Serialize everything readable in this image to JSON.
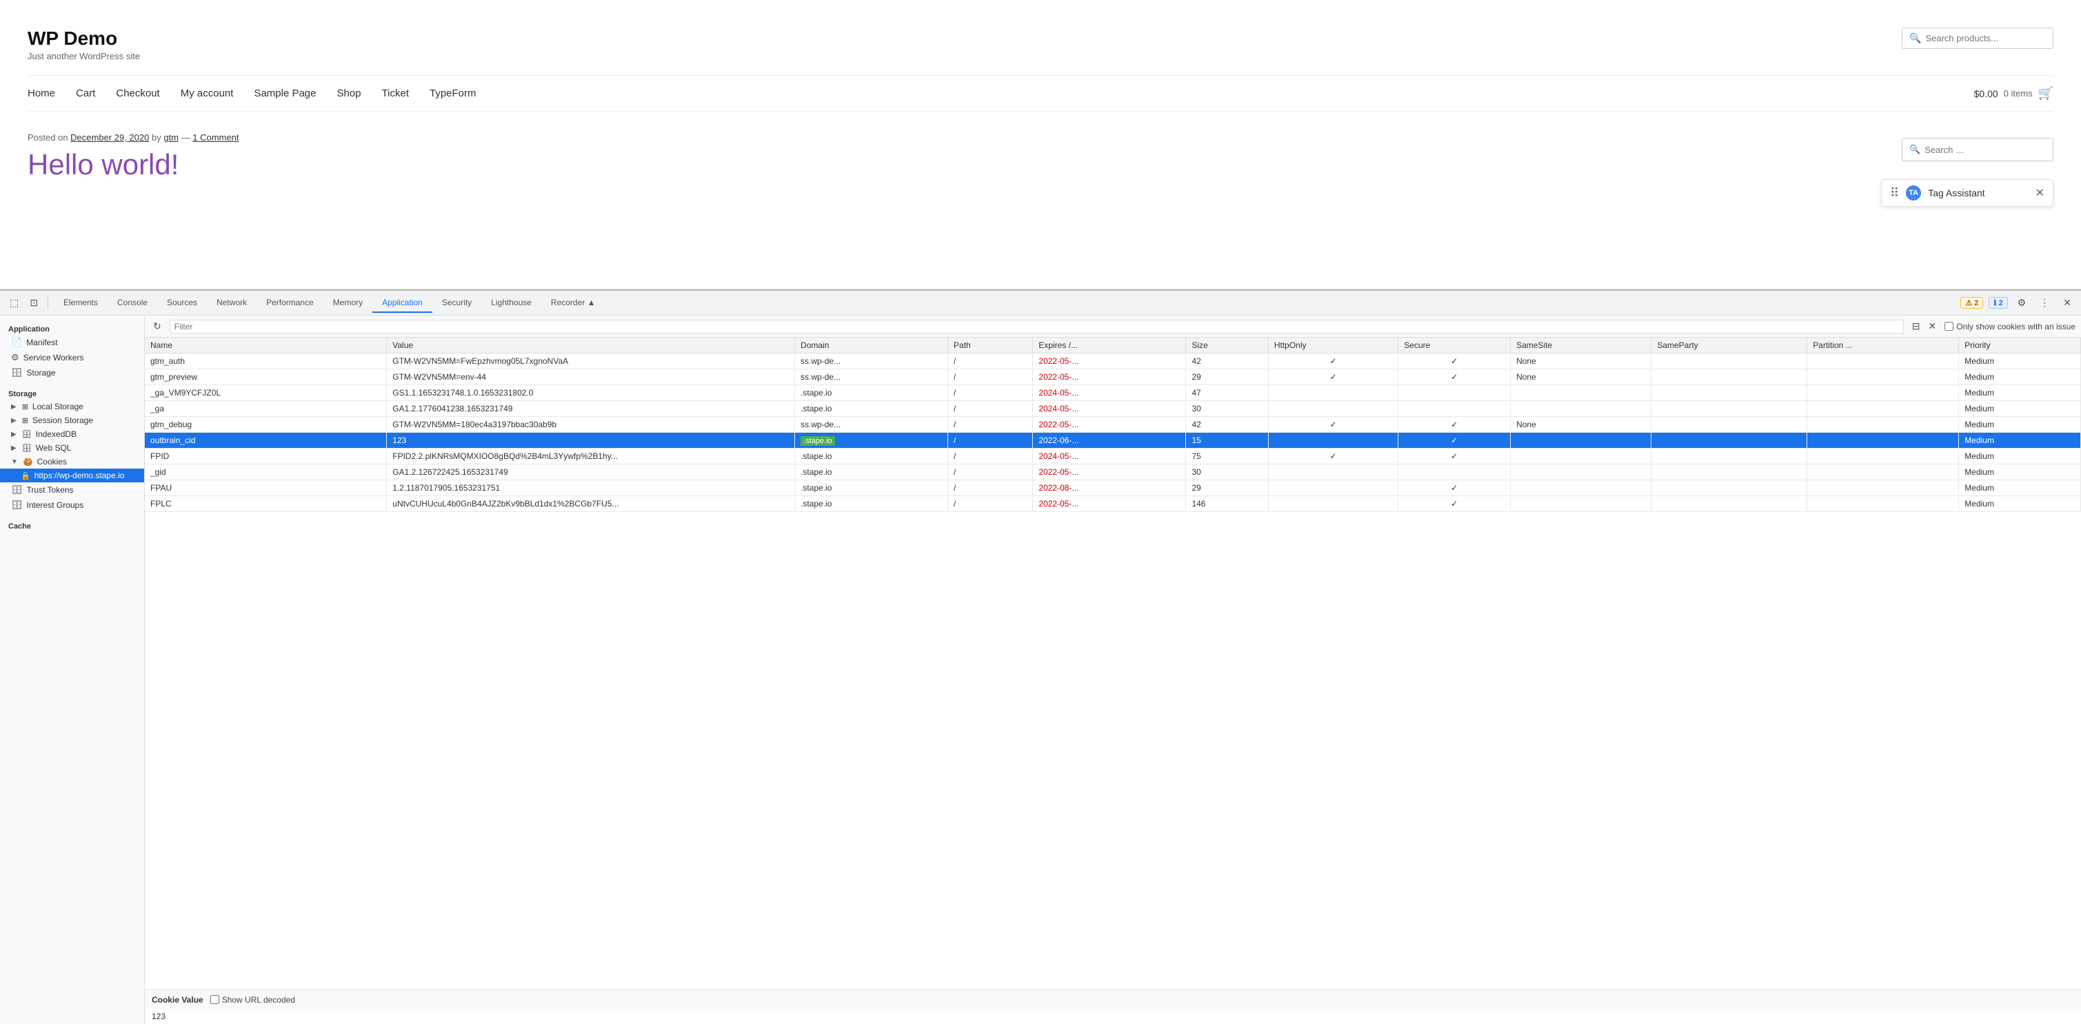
{
  "website": {
    "title": "WP Demo",
    "tagline": "Just another WordPress site",
    "search_placeholder": "Search products...",
    "nav": {
      "items": [
        "Home",
        "Cart",
        "Checkout",
        "My account",
        "Sample Page",
        "Shop",
        "Ticket",
        "TypeForm"
      ]
    },
    "cart": {
      "price": "$0.00",
      "items_text": "0 items"
    },
    "post": {
      "posted_on_text": "Posted on",
      "date": "December 29, 2020",
      "by_text": "by",
      "author": "gtm",
      "separator": "—",
      "comment_link": "1 Comment",
      "title": "Hello world!"
    },
    "sidebar": {
      "search_placeholder": "Search …"
    },
    "tag_assistant": {
      "label": "Tag Assistant"
    }
  },
  "devtools": {
    "tabs": [
      {
        "label": "Elements"
      },
      {
        "label": "Console"
      },
      {
        "label": "Sources"
      },
      {
        "label": "Network"
      },
      {
        "label": "Performance"
      },
      {
        "label": "Memory"
      },
      {
        "label": "Application",
        "active": true
      },
      {
        "label": "Security"
      },
      {
        "label": "Lighthouse"
      },
      {
        "label": "Recorder ▲"
      }
    ],
    "badges": {
      "warning": "2",
      "info": "2"
    },
    "sidebar": {
      "application_section": "Application",
      "application_items": [
        {
          "label": "Manifest",
          "icon": "📄"
        },
        {
          "label": "Service Workers",
          "icon": "⚙"
        },
        {
          "label": "Storage",
          "icon": "🗄"
        }
      ],
      "storage_section": "Storage",
      "storage_items": [
        {
          "label": "Local Storage",
          "expandable": true
        },
        {
          "label": "Session Storage",
          "expandable": true
        },
        {
          "label": "IndexedDB",
          "icon": ""
        },
        {
          "label": "Web SQL",
          "icon": ""
        },
        {
          "label": "Cookies",
          "expandable": true,
          "expanded": true
        },
        {
          "label": "Trust Tokens",
          "icon": ""
        },
        {
          "label": "Interest Groups",
          "icon": ""
        }
      ],
      "cookies_child": "https://wp-demo.stape.io",
      "cache_section": "Cache"
    },
    "cookies_panel": {
      "filter_placeholder": "Filter",
      "only_issues_label": "Only show cookies with an issue",
      "columns": [
        "Name",
        "Value",
        "Domain",
        "Path",
        "Expires /...",
        "Size",
        "HttpOnly",
        "Secure",
        "SameSite",
        "SameParty",
        "Partition ...",
        "Priority"
      ],
      "rows": [
        {
          "name": "gtm_auth",
          "value": "GTM-W2VN5MM=FwEpzhvmog05L7xgnoNVaA",
          "domain": "ss.wp-de...",
          "path": "/",
          "expires": "2022-05-...",
          "size": "42",
          "httponly": true,
          "secure": true,
          "samesite": "None",
          "sameparty": "",
          "partition": "",
          "priority": "Medium",
          "highlighted": false
        },
        {
          "name": "gtm_preview",
          "value": "GTM-W2VN5MM=env-44",
          "domain": "ss.wp-de...",
          "path": "/",
          "expires": "2022-05-...",
          "size": "29",
          "httponly": true,
          "secure": true,
          "samesite": "None",
          "sameparty": "",
          "partition": "",
          "priority": "Medium",
          "highlighted": false
        },
        {
          "name": "_ga_VM9YCFJZ0L",
          "value": "GS1.1.1653231748.1.0.1653231802.0",
          "domain": ".stape.io",
          "path": "/",
          "expires": "2024-05-...",
          "size": "47",
          "httponly": false,
          "secure": false,
          "samesite": "",
          "sameparty": "",
          "partition": "",
          "priority": "Medium",
          "highlighted": false
        },
        {
          "name": "_ga",
          "value": "GA1.2.1776041238.1653231749",
          "domain": ".stape.io",
          "path": "/",
          "expires": "2024-05-...",
          "size": "30",
          "httponly": false,
          "secure": false,
          "samesite": "",
          "sameparty": "",
          "partition": "",
          "priority": "Medium",
          "highlighted": false
        },
        {
          "name": "gtm_debug",
          "value": "GTM-W2VN5MM=180ec4a3197bbac30ab9b",
          "domain": "ss.wp-de...",
          "path": "/",
          "expires": "2022-05-...",
          "size": "42",
          "httponly": true,
          "secure": true,
          "samesite": "None",
          "sameparty": "",
          "partition": "",
          "priority": "Medium",
          "highlighted": false
        },
        {
          "name": "outbrain_cid",
          "value": "123",
          "domain": ".stape.io",
          "path": "/",
          "expires": "2022-06-...",
          "size": "15",
          "httponly": false,
          "secure": true,
          "samesite": "",
          "sameparty": "",
          "partition": "",
          "priority": "Medium",
          "highlighted": true
        },
        {
          "name": "FPID",
          "value": "FPID2.2.plKNRsMQMXIOO8gBQd%2B4mL3Yywfp%2B1hy...",
          "domain": ".stape.io",
          "path": "/",
          "expires": "2024-05-...",
          "size": "75",
          "httponly": true,
          "secure": true,
          "samesite": "",
          "sameparty": "",
          "partition": "",
          "priority": "Medium",
          "highlighted": false
        },
        {
          "name": "_gid",
          "value": "GA1.2.126722425.1653231749",
          "domain": ".stape.io",
          "path": "/",
          "expires": "2022-05-...",
          "size": "30",
          "httponly": false,
          "secure": false,
          "samesite": "",
          "sameparty": "",
          "partition": "",
          "priority": "Medium",
          "highlighted": false
        },
        {
          "name": "FPAU",
          "value": "1.2.1187017905.1653231751",
          "domain": ".stape.io",
          "path": "/",
          "expires": "2022-08-...",
          "size": "29",
          "httponly": false,
          "secure": true,
          "samesite": "",
          "sameparty": "",
          "partition": "",
          "priority": "Medium",
          "highlighted": false
        },
        {
          "name": "FPLC",
          "value": "uNtvCUHUcuL4b0GnB4AJZ2bKv9bBLd1dx1%2BCGb7FU5...",
          "domain": ".stape.io",
          "path": "/",
          "expires": "2022-05-...",
          "size": "146",
          "httponly": false,
          "secure": true,
          "samesite": "",
          "sameparty": "",
          "partition": "",
          "priority": "Medium",
          "highlighted": false
        }
      ],
      "cookie_value_section": {
        "label": "Cookie Value",
        "show_url_decoded_label": "Show URL decoded",
        "value": "123"
      }
    }
  }
}
